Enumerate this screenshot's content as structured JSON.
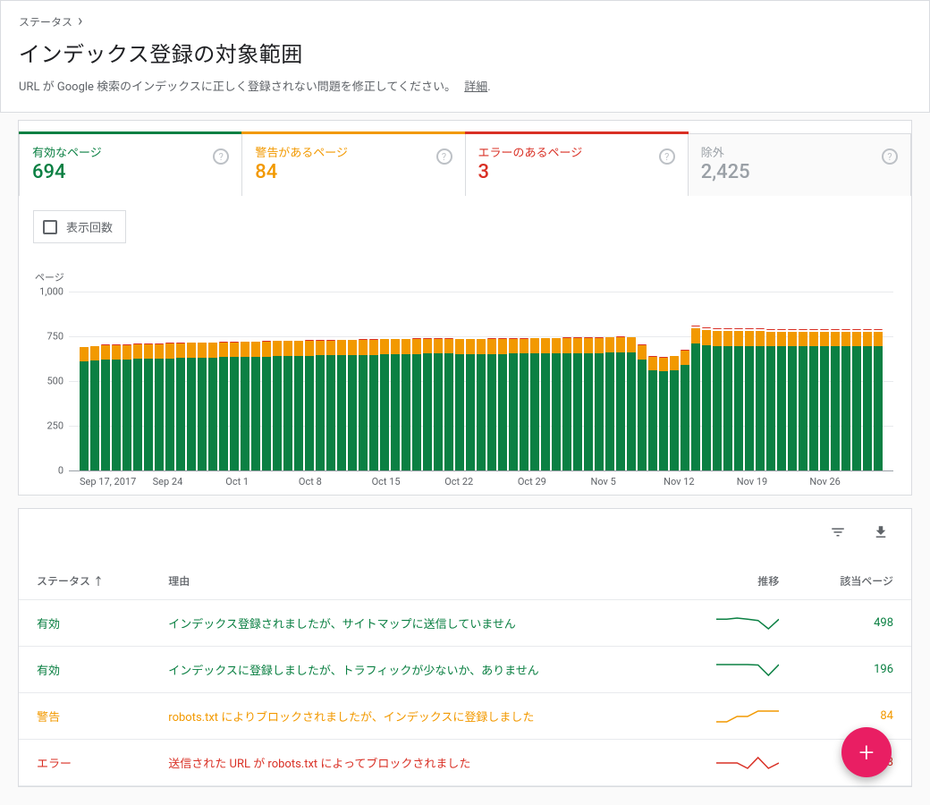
{
  "breadcrumb": {
    "item": "ステータス"
  },
  "header": {
    "title": "インデックス登録の対象範囲",
    "subtitle": "URL が Google 検索のインデックスに正しく登録されない問題を修正してください。",
    "more_link": "詳細"
  },
  "tabs": [
    {
      "label": "有効なページ",
      "value": "694",
      "color": "green",
      "active": true
    },
    {
      "label": "警告があるページ",
      "value": "84",
      "color": "orange",
      "active": true
    },
    {
      "label": "エラーのあるページ",
      "value": "3",
      "color": "red",
      "active": true
    },
    {
      "label": "除外",
      "value": "2,425",
      "color": "gray",
      "active": false
    }
  ],
  "impressions_label": "表示回数",
  "chart_data": {
    "type": "bar",
    "ylabel": "ページ",
    "ylim": [
      0,
      1000
    ],
    "y_ticks": [
      0,
      250,
      500,
      750,
      1000
    ],
    "x_ticks": [
      "Sep 17, 2017",
      "Sep 24",
      "Oct 1",
      "Oct 8",
      "Oct 15",
      "Oct 22",
      "Oct 29",
      "Nov 5",
      "Nov 12",
      "Nov 19",
      "Nov 26"
    ],
    "series_order": [
      "valid",
      "warning",
      "error"
    ],
    "series_colors": {
      "valid": "#0b8043",
      "warning": "#f29900",
      "error": "#d93025"
    },
    "stacked": true,
    "data": [
      {
        "g": 610,
        "o": 80,
        "r": 3
      },
      {
        "g": 615,
        "o": 80,
        "r": 3
      },
      {
        "g": 620,
        "o": 82,
        "r": 3
      },
      {
        "g": 620,
        "o": 82,
        "r": 3
      },
      {
        "g": 620,
        "o": 82,
        "r": 3
      },
      {
        "g": 625,
        "o": 82,
        "r": 3
      },
      {
        "g": 625,
        "o": 83,
        "r": 3
      },
      {
        "g": 625,
        "o": 83,
        "r": 3
      },
      {
        "g": 628,
        "o": 83,
        "r": 3
      },
      {
        "g": 630,
        "o": 83,
        "r": 3
      },
      {
        "g": 632,
        "o": 83,
        "r": 3
      },
      {
        "g": 632,
        "o": 83,
        "r": 3
      },
      {
        "g": 632,
        "o": 83,
        "r": 3
      },
      {
        "g": 634,
        "o": 83,
        "r": 3
      },
      {
        "g": 634,
        "o": 83,
        "r": 3
      },
      {
        "g": 636,
        "o": 83,
        "r": 3
      },
      {
        "g": 636,
        "o": 84,
        "r": 3
      },
      {
        "g": 638,
        "o": 84,
        "r": 3
      },
      {
        "g": 640,
        "o": 84,
        "r": 3
      },
      {
        "g": 640,
        "o": 84,
        "r": 3
      },
      {
        "g": 640,
        "o": 84,
        "r": 3
      },
      {
        "g": 642,
        "o": 84,
        "r": 3
      },
      {
        "g": 644,
        "o": 84,
        "r": 3
      },
      {
        "g": 644,
        "o": 84,
        "r": 3
      },
      {
        "g": 646,
        "o": 84,
        "r": 3
      },
      {
        "g": 646,
        "o": 84,
        "r": 3
      },
      {
        "g": 648,
        "o": 84,
        "r": 3
      },
      {
        "g": 648,
        "o": 84,
        "r": 3
      },
      {
        "g": 650,
        "o": 84,
        "r": 3
      },
      {
        "g": 650,
        "o": 84,
        "r": 3
      },
      {
        "g": 650,
        "o": 84,
        "r": 3
      },
      {
        "g": 652,
        "o": 84,
        "r": 3
      },
      {
        "g": 654,
        "o": 84,
        "r": 3
      },
      {
        "g": 654,
        "o": 84,
        "r": 3
      },
      {
        "g": 654,
        "o": 84,
        "r": 3
      },
      {
        "g": 650,
        "o": 84,
        "r": 3
      },
      {
        "g": 650,
        "o": 84,
        "r": 3
      },
      {
        "g": 650,
        "o": 84,
        "r": 3
      },
      {
        "g": 652,
        "o": 84,
        "r": 3
      },
      {
        "g": 652,
        "o": 84,
        "r": 3
      },
      {
        "g": 654,
        "o": 84,
        "r": 3
      },
      {
        "g": 654,
        "o": 84,
        "r": 3
      },
      {
        "g": 656,
        "o": 84,
        "r": 3
      },
      {
        "g": 656,
        "o": 84,
        "r": 3
      },
      {
        "g": 656,
        "o": 84,
        "r": 3
      },
      {
        "g": 658,
        "o": 84,
        "r": 3
      },
      {
        "g": 658,
        "o": 84,
        "r": 3
      },
      {
        "g": 658,
        "o": 84,
        "r": 3
      },
      {
        "g": 658,
        "o": 84,
        "r": 3
      },
      {
        "g": 660,
        "o": 84,
        "r": 3
      },
      {
        "g": 662,
        "o": 84,
        "r": 3
      },
      {
        "g": 660,
        "o": 84,
        "r": 3
      },
      {
        "g": 620,
        "o": 82,
        "r": 3
      },
      {
        "g": 560,
        "o": 78,
        "r": 3
      },
      {
        "g": 555,
        "o": 78,
        "r": 3
      },
      {
        "g": 560,
        "o": 80,
        "r": 3
      },
      {
        "g": 590,
        "o": 82,
        "r": 3
      },
      {
        "g": 710,
        "o": 88,
        "r": 4
      },
      {
        "g": 700,
        "o": 86,
        "r": 4
      },
      {
        "g": 695,
        "o": 85,
        "r": 4
      },
      {
        "g": 695,
        "o": 85,
        "r": 4
      },
      {
        "g": 695,
        "o": 85,
        "r": 4
      },
      {
        "g": 695,
        "o": 85,
        "r": 4
      },
      {
        "g": 695,
        "o": 85,
        "r": 4
      },
      {
        "g": 694,
        "o": 84,
        "r": 3
      },
      {
        "g": 694,
        "o": 84,
        "r": 3
      },
      {
        "g": 694,
        "o": 84,
        "r": 3
      },
      {
        "g": 694,
        "o": 84,
        "r": 3
      },
      {
        "g": 694,
        "o": 84,
        "r": 3
      },
      {
        "g": 694,
        "o": 84,
        "r": 3
      },
      {
        "g": 694,
        "o": 84,
        "r": 3
      },
      {
        "g": 694,
        "o": 84,
        "r": 3
      },
      {
        "g": 694,
        "o": 84,
        "r": 3
      },
      {
        "g": 694,
        "o": 84,
        "r": 3
      },
      {
        "g": 694,
        "o": 84,
        "r": 3
      }
    ]
  },
  "table": {
    "columns": {
      "status": "ステータス",
      "reason": "理由",
      "trend": "推移",
      "pages": "該当ページ"
    },
    "rows": [
      {
        "status_key": "valid",
        "status": "有効",
        "reason": "インデックス登録されましたが、サイトマップに送信していません",
        "pages": "498",
        "spark": [
          498,
          498,
          499,
          498,
          497,
          490,
          498
        ]
      },
      {
        "status_key": "valid",
        "status": "有効",
        "reason": "インデックスに登録しましたが、トラフィックが少ないか、ありません",
        "pages": "196",
        "spark": [
          196,
          196,
          196,
          196,
          195,
          170,
          196
        ]
      },
      {
        "status_key": "warn",
        "status": "警告",
        "reason": "robots.txt によりブロックされましたが、インデックスに登録しました",
        "pages": "84",
        "spark": [
          82,
          82,
          83,
          83,
          84,
          84,
          84
        ]
      },
      {
        "status_key": "err",
        "status": "エラー",
        "reason": "送信された URL が robots.txt によってブロックされました",
        "pages": "3",
        "spark": [
          3,
          3,
          3,
          2,
          4,
          2,
          3
        ]
      }
    ]
  },
  "fab_label": "+"
}
